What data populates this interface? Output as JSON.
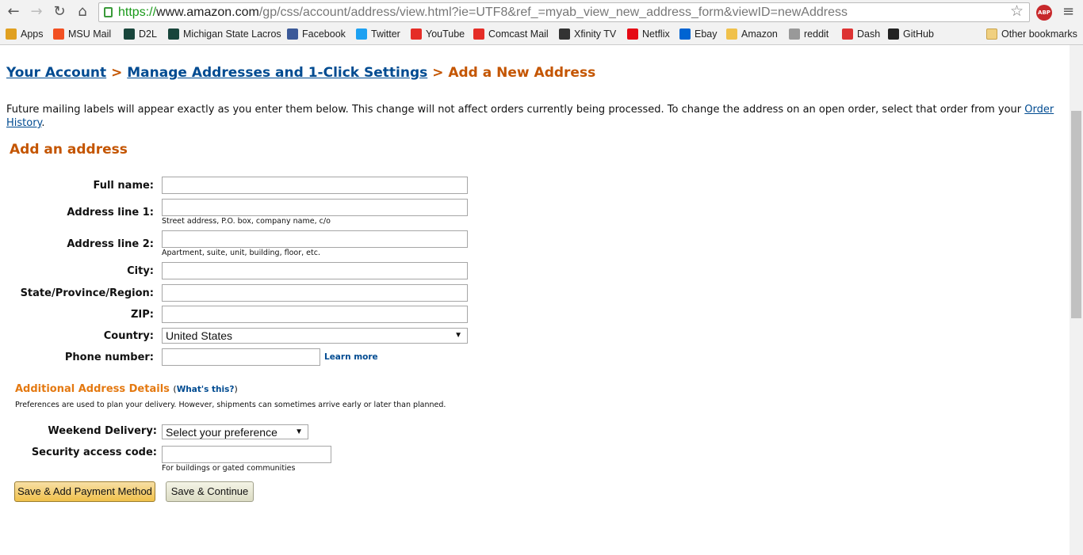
{
  "browser": {
    "url_scheme": "https://",
    "url_host": "www.amazon.com",
    "url_path": "/gp/css/account/address/view.html?ie=UTF8&ref_=myab_view_new_address_form&viewID=newAddress",
    "abp_badge": "ABP",
    "bookmarks": [
      {
        "label": "Apps",
        "icon": "apps-grid-icon",
        "color": "#e0a020"
      },
      {
        "label": "MSU Mail",
        "icon": "microsoft-icon",
        "color": "#f25022"
      },
      {
        "label": "D2L",
        "icon": "s-logo-icon",
        "color": "#18453b"
      },
      {
        "label": "Michigan State Lacros",
        "icon": "spartan-icon",
        "color": "#18453b"
      },
      {
        "label": "Facebook",
        "icon": "facebook-icon",
        "color": "#3b5998"
      },
      {
        "label": "Twitter",
        "icon": "twitter-icon",
        "color": "#1da1f2"
      },
      {
        "label": "YouTube",
        "icon": "youtube-icon",
        "color": "#e52d27"
      },
      {
        "label": "Comcast Mail",
        "icon": "xfinity-icon",
        "color": "#e52d27"
      },
      {
        "label": "Xfinity TV",
        "icon": "play-icon",
        "color": "#333333"
      },
      {
        "label": "Netflix",
        "icon": "netflix-icon",
        "color": "#e50914"
      },
      {
        "label": "Ebay",
        "icon": "ebay-bag-icon",
        "color": "#0064d2"
      },
      {
        "label": "Amazon",
        "icon": "amazon-icon",
        "color": "#f0c14b"
      },
      {
        "label": "reddit",
        "icon": "reddit-icon",
        "color": "#999999"
      },
      {
        "label": "Dash",
        "icon": "dash-icon",
        "color": "#d33"
      },
      {
        "label": "GitHub",
        "icon": "github-icon",
        "color": "#222222"
      }
    ],
    "other_bookmarks": "Other bookmarks"
  },
  "breadcrumb": {
    "item1": "Your Account",
    "sep": ">",
    "item2": "Manage Addresses and 1-Click Settings",
    "current": "Add a New Address"
  },
  "intro": {
    "text": "Future mailing labels will appear exactly as you enter them below. This change will not affect orders currently being processed. To change the address on an open order, select that order from your ",
    "link": "Order History",
    "end": "."
  },
  "form": {
    "title": "Add an address",
    "full_name": "Full name:",
    "address1": "Address line 1:",
    "address1_hint": "Street address, P.O. box, company name, c/o",
    "address2": "Address line 2:",
    "address2_hint": "Apartment, suite, unit, building, floor, etc.",
    "city": "City:",
    "state": "State/Province/Region:",
    "zip": "ZIP:",
    "country": "Country:",
    "country_value": "United States",
    "phone": "Phone number:",
    "learn_more": "Learn more"
  },
  "additional": {
    "title": "Additional Address Details",
    "paren_open": "(",
    "whats_this": "What's this?",
    "paren_close": ")",
    "description": "Preferences are used to plan your delivery. However, shipments can sometimes arrive early or later than planned.",
    "weekend": "Weekend Delivery:",
    "weekend_value": "Select your preference",
    "security": "Security access code:",
    "security_hint": "For buildings or gated communities"
  },
  "buttons": {
    "primary": "Save & Add Payment Method",
    "secondary": "Save & Continue"
  }
}
